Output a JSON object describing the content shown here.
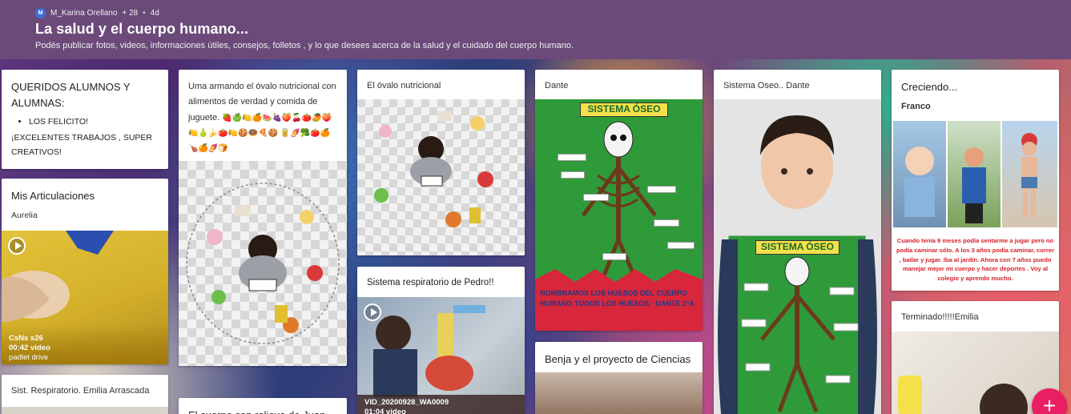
{
  "header": {
    "avatar_letter": "M",
    "author": "M_Karina Orellano",
    "likes": "+ 28",
    "separator": "•",
    "age": "4d",
    "title": "La salud y el cuerpo humano...",
    "description": "Podés publicar fotos, videos, informaciones útiles, consejos, folletos , y lo que desees acerca de la salud y el cuidado del cuerpo humano."
  },
  "col1": {
    "card1": {
      "title": "QUERIDOS ALUMNOS Y ALUMNAS:",
      "bullet": "LOS FELICITO!",
      "text": "¡EXCELENTES TRABAJOS , SUPER CREATIVOS!"
    },
    "card2": {
      "title": "Mis Articulaciones",
      "subtitle": "Aurelia",
      "video_name": "CsNs s26",
      "video_duration": "00:42 video",
      "video_source": "padlet drive"
    },
    "card3": {
      "title": "Sist. Respiratorio. Emilia Arrascada"
    }
  },
  "col2": {
    "card1": {
      "title": "Uma armando el óvalo nutricional con alimentos de verdad y comida de juguete.",
      "emojis": "🍓🍏🍋🍊🍉🍇🍑🍒🍅🥭🍑🍋🍐🍌🍅🍋🍪🍩🍕🍪 🥫🍠🥦🍅🍊🍗🍊🍠🍞"
    },
    "card2": {
      "title": "El cuerpo con relieve de Juan"
    }
  },
  "col3": {
    "card1": {
      "title": "El óvalo nutricional"
    },
    "card2": {
      "title": "Sistema respiratorio de Pedro!!",
      "video_name": "VID_20200928_WA0009",
      "video_duration": "01:04 video"
    }
  },
  "col4": {
    "card1": {
      "title": "Dante",
      "poster_heading": "SISTEMA ÓSEO",
      "poster_footer": "NOMBRAMOS LOS HUESOS DEL CUERPO HUMANO TODOS LOS HUESOS · DANTE 2°A"
    },
    "card2": {
      "title": "Benja y el proyecto de Ciencias"
    }
  },
  "col5": {
    "card1": {
      "title": "Sistema Oseo.. Dante",
      "poster_heading": "SISTEMA ÓSEO"
    }
  },
  "col6": {
    "card1": {
      "title": "Creciendo...",
      "subtitle": "Franco",
      "collage_text": "Cuando tenía 9 meses podía sentarme a jugar pero no podía caminar sólo. A los 3 años podía caminar, correr , bailar y jugar. Iba al jardín. Ahora con 7 años puedo manejar mejor mi cuerpo y hacer deportes . Voy al colegio y aprendo mucho."
    },
    "card2": {
      "title": "Terminado!!!!!Emilia"
    }
  },
  "fab": {
    "label": "+"
  },
  "colors": {
    "header_bg": "#6b4a7a",
    "fab": "#e91e63",
    "poster_green": "#2f9a3a",
    "poster_red": "#d8263a",
    "video_gold": "#c9a21a"
  }
}
